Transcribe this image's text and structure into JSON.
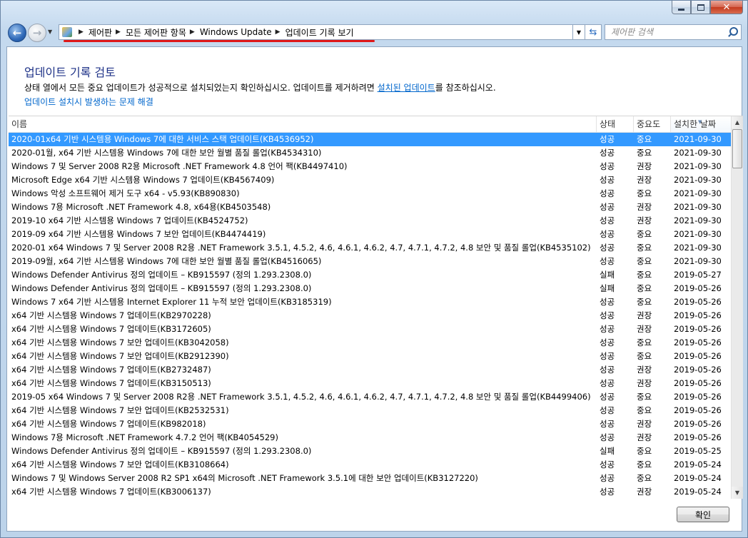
{
  "window": {
    "close_glyph": "✕"
  },
  "nav": {
    "back_glyph": "←",
    "forward_glyph": "→",
    "breadcrumbs": [
      "제어판",
      "모든 제어판 항목",
      "Windows Update",
      "업데이트 기록 보기"
    ],
    "search_placeholder": "제어판 검색",
    "underline_color": "#e01818"
  },
  "page": {
    "title": "업데이트 기록 검토",
    "description_before": "상태 열에서 모든 중요 업데이트가 성공적으로 설치되었는지 확인하십시오. 업데이트를 제거하려면 ",
    "description_link": "설치된 업데이트",
    "description_after": "를 참조하십시오.",
    "help_link": "업데이트 설치시 발생하는 문제 해결"
  },
  "table": {
    "columns": {
      "name": "이름",
      "status": "상태",
      "importance": "중요도",
      "date": "설치한 날짜"
    },
    "rows": [
      {
        "name": "2020-01x64 기반 시스템용 Windows 7에 대한 서비스 스택 업데이트(KB4536952)",
        "status": "성공",
        "importance": "중요",
        "date": "2021-09-30"
      },
      {
        "name": "2020-01월, x64 기반 시스템용 Windows 7에 대한 보안 월별 품질 롤업(KB4534310)",
        "status": "성공",
        "importance": "중요",
        "date": "2021-09-30"
      },
      {
        "name": "Windows 7 및 Server 2008 R2용 Microsoft .NET Framework 4.8 언어 팩(KB4497410)",
        "status": "성공",
        "importance": "권장",
        "date": "2021-09-30"
      },
      {
        "name": "Microsoft Edge x64 기반 시스템용 Windows 7 업데이트(KB4567409)",
        "status": "성공",
        "importance": "권장",
        "date": "2021-09-30"
      },
      {
        "name": "Windows 악성 소프트웨어 제거 도구 x64 - v5.93(KB890830)",
        "status": "성공",
        "importance": "중요",
        "date": "2021-09-30"
      },
      {
        "name": "Windows 7용 Microsoft .NET Framework 4.8, x64용(KB4503548)",
        "status": "성공",
        "importance": "권장",
        "date": "2021-09-30"
      },
      {
        "name": "2019-10 x64 기반 시스템용 Windows 7 업데이트(KB4524752)",
        "status": "성공",
        "importance": "권장",
        "date": "2021-09-30"
      },
      {
        "name": "2019-09 x64 기반 시스템용 Windows 7 보안 업데이트(KB4474419)",
        "status": "성공",
        "importance": "중요",
        "date": "2021-09-30"
      },
      {
        "name": "2020-01 x64 Windows 7 및 Server 2008 R2용 .NET Framework 3.5.1, 4.5.2, 4.6, 4.6.1, 4.6.2, 4.7, 4.7.1, 4.7.2, 4.8 보안 및 품질 롤업(KB4535102)",
        "status": "성공",
        "importance": "중요",
        "date": "2021-09-30"
      },
      {
        "name": "2019-09월, x64 기반 시스템용 Windows 7에 대한 보안 월별 품질 롤업(KB4516065)",
        "status": "성공",
        "importance": "중요",
        "date": "2021-09-30"
      },
      {
        "name": "Windows Defender Antivirus 정의 업데이트 – KB915597 (정의 1.293.2308.0)",
        "status": "실패",
        "importance": "중요",
        "date": "2019-05-27"
      },
      {
        "name": "Windows Defender Antivirus 정의 업데이트 – KB915597 (정의 1.293.2308.0)",
        "status": "실패",
        "importance": "중요",
        "date": "2019-05-26"
      },
      {
        "name": "Windows 7 x64 기반 시스템용 Internet Explorer 11 누적 보안 업데이트(KB3185319)",
        "status": "성공",
        "importance": "중요",
        "date": "2019-05-26"
      },
      {
        "name": "x64 기반 시스템용 Windows 7 업데이트(KB2970228)",
        "status": "성공",
        "importance": "권장",
        "date": "2019-05-26"
      },
      {
        "name": "x64 기반 시스템용 Windows 7 업데이트(KB3172605)",
        "status": "성공",
        "importance": "권장",
        "date": "2019-05-26"
      },
      {
        "name": "x64 기반 시스템용 Windows 7 보안 업데이트(KB3042058)",
        "status": "성공",
        "importance": "중요",
        "date": "2019-05-26"
      },
      {
        "name": "x64 기반 시스템용 Windows 7 보안 업데이트(KB2912390)",
        "status": "성공",
        "importance": "중요",
        "date": "2019-05-26"
      },
      {
        "name": "x64 기반 시스템용 Windows 7 업데이트(KB2732487)",
        "status": "성공",
        "importance": "권장",
        "date": "2019-05-26"
      },
      {
        "name": "x64 기반 시스템용 Windows 7 업데이트(KB3150513)",
        "status": "성공",
        "importance": "권장",
        "date": "2019-05-26"
      },
      {
        "name": "2019-05 x64 Windows 7 및 Server 2008 R2용 .NET Framework 3.5.1, 4.5.2, 4.6, 4.6.1, 4.6.2, 4.7, 4.7.1, 4.7.2, 4.8 보안 및 품질 롤업(KB4499406)",
        "status": "성공",
        "importance": "중요",
        "date": "2019-05-26"
      },
      {
        "name": "x64 기반 시스템용 Windows 7 보안 업데이트(KB2532531)",
        "status": "성공",
        "importance": "중요",
        "date": "2019-05-26"
      },
      {
        "name": "x64 기반 시스템용 Windows 7 업데이트(KB982018)",
        "status": "성공",
        "importance": "권장",
        "date": "2019-05-26"
      },
      {
        "name": "Windows 7용 Microsoft .NET Framework 4.7.2 언어 팩(KB4054529)",
        "status": "성공",
        "importance": "권장",
        "date": "2019-05-26"
      },
      {
        "name": "Windows Defender Antivirus 정의 업데이트 – KB915597 (정의 1.293.2308.0)",
        "status": "실패",
        "importance": "중요",
        "date": "2019-05-25"
      },
      {
        "name": "x64 기반 시스템용 Windows 7 보안 업데이트(KB3108664)",
        "status": "성공",
        "importance": "중요",
        "date": "2019-05-24"
      },
      {
        "name": "Windows 7 및 Windows Server 2008 R2 SP1 x64의 Microsoft .NET Framework 3.5.1에 대한 보안 업데이트(KB3127220)",
        "status": "성공",
        "importance": "중요",
        "date": "2019-05-24"
      },
      {
        "name": "x64 기반 시스템용 Windows 7 업데이트(KB3006137)",
        "status": "성공",
        "importance": "권장",
        "date": "2019-05-24"
      }
    ],
    "selected_index": 0,
    "selection_color": "#3399ff"
  },
  "buttons": {
    "ok": "확인"
  }
}
